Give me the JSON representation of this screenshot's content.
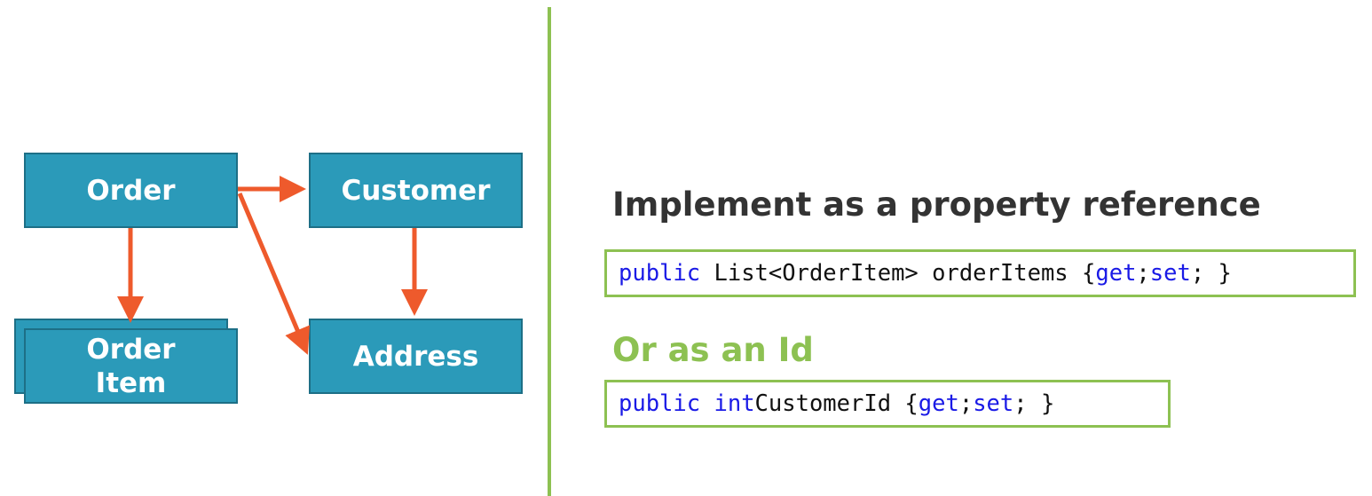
{
  "diagram": {
    "nodes": {
      "order": "Order",
      "customer": "Customer",
      "order_item": "Order Item",
      "address": "Address"
    },
    "edges": [
      {
        "from": "Order",
        "to": "Customer"
      },
      {
        "from": "Order",
        "to": "Order Item"
      },
      {
        "from": "Order",
        "to": "Address"
      },
      {
        "from": "Customer",
        "to": "Address"
      }
    ],
    "colors": {
      "node_fill": "#2b9ab9",
      "node_border": "#1d6f86",
      "arrow": "#ee5a2c",
      "divider": "#8dc152"
    }
  },
  "right_panel": {
    "heading": "Implement as a property reference",
    "alt_heading": "Or as an Id",
    "code1": {
      "kw_public": "public",
      "type": "List<OrderItem> orderItems { ",
      "kw_get": "get",
      "sep": "; ",
      "kw_set": "set",
      "end": "; }"
    },
    "code2": {
      "kw_public": "public",
      "kw_int": "int",
      "name": " CustomerId { ",
      "kw_get": "get",
      "sep": "; ",
      "kw_set": "set",
      "end": "; }"
    },
    "colors": {
      "heading": "#333333",
      "alt_heading": "#8dc152",
      "code_border": "#8dc152",
      "keyword": "#1a1ae6"
    }
  }
}
